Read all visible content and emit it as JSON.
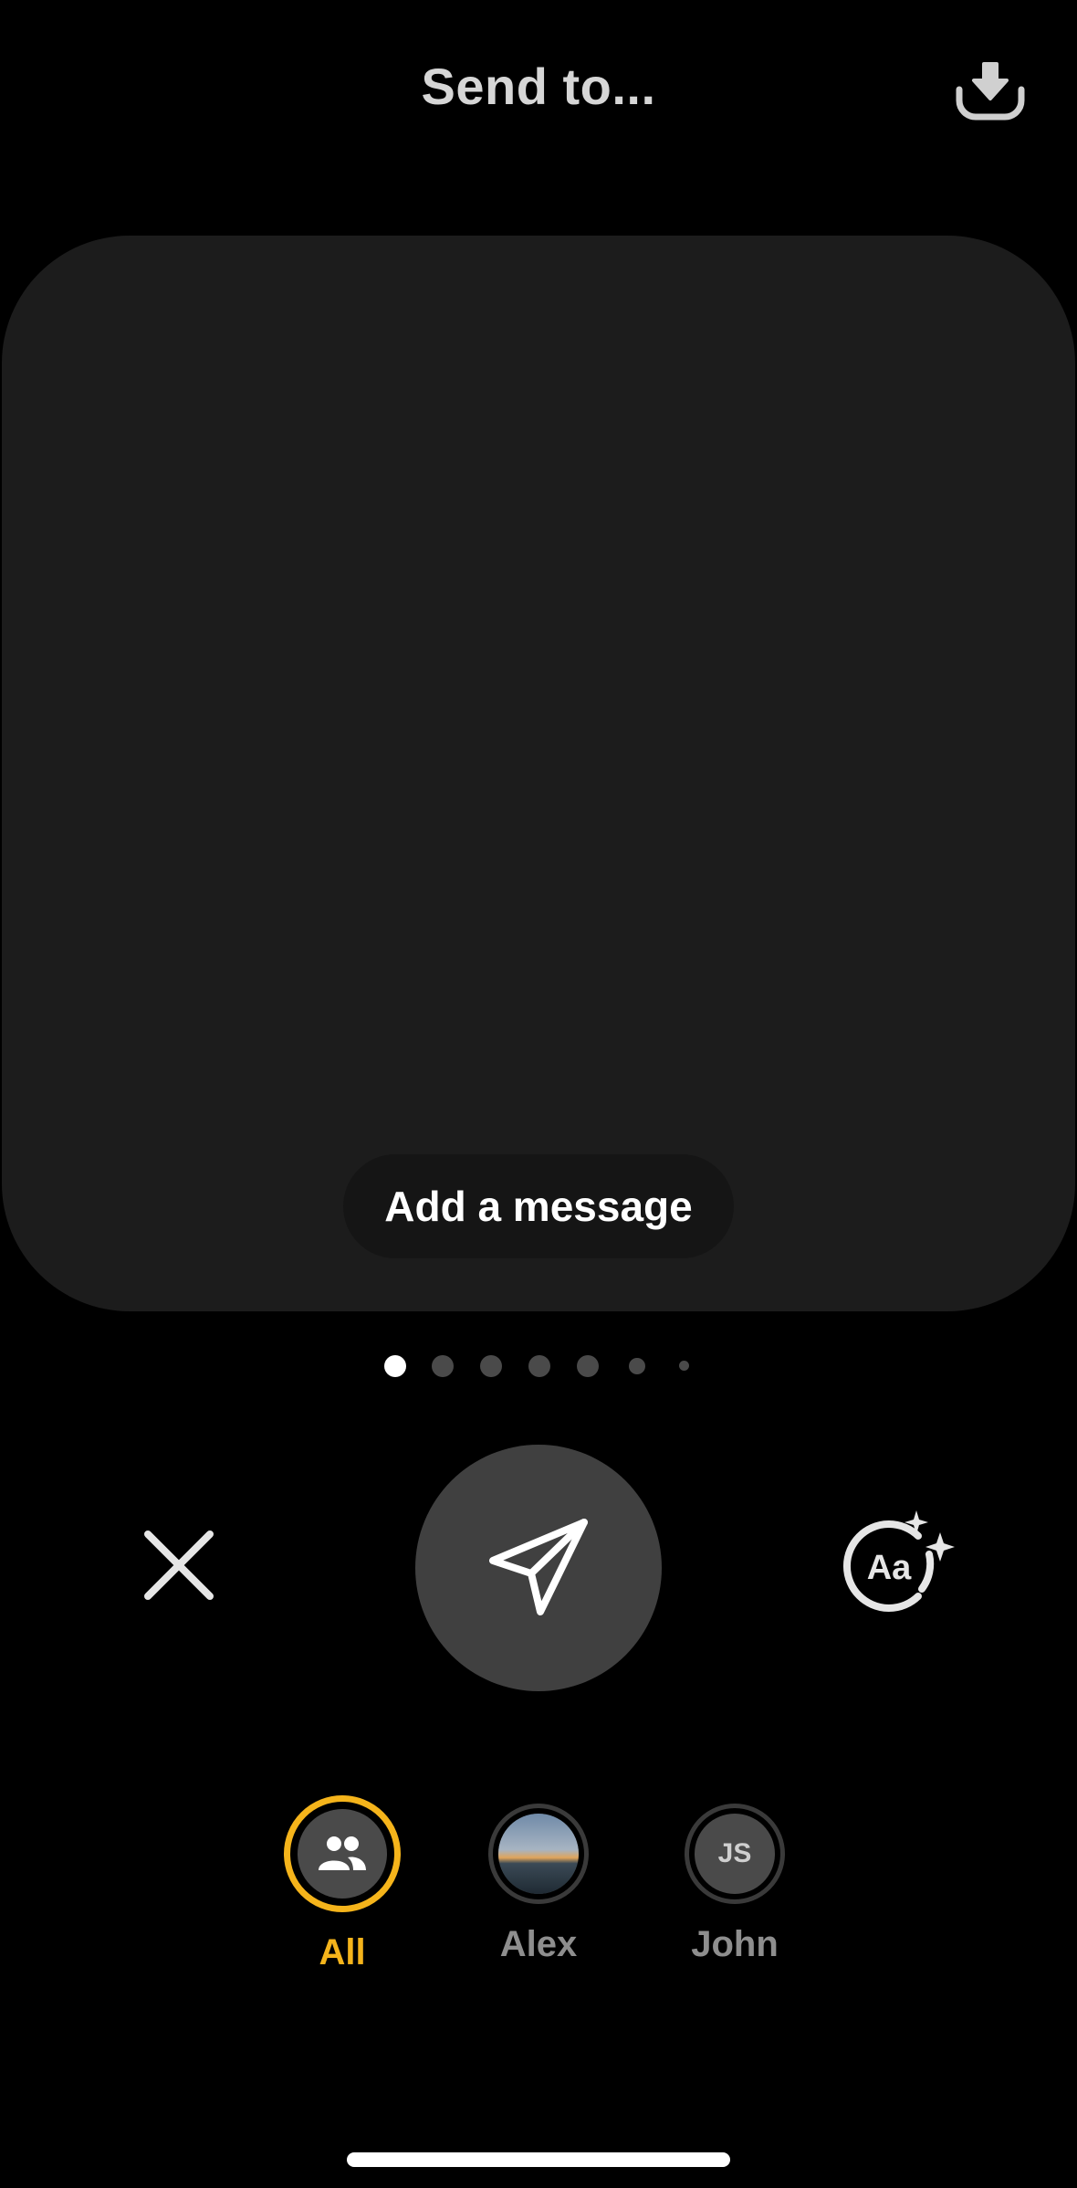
{
  "header": {
    "title": "Send to...",
    "download_icon": "download-icon"
  },
  "preview": {
    "message_placeholder": "Add a message"
  },
  "pagination": {
    "count": 7,
    "active_index": 0
  },
  "actions": {
    "close_icon": "close-icon",
    "send_icon": "paper-plane-icon",
    "text_style_icon": "text-style-sparkle-icon",
    "text_style_glyph": "Aa"
  },
  "recipients": [
    {
      "label": "All",
      "icon": "group-icon",
      "selected": true
    },
    {
      "label": "Alex",
      "icon": "photo-avatar",
      "selected": false
    },
    {
      "label": "John",
      "initials": "JS",
      "selected": false
    }
  ],
  "colors": {
    "accent": "#f5b41b",
    "background": "#000000",
    "card": "#1c1c1c",
    "muted_label": "#8e8e8e"
  }
}
